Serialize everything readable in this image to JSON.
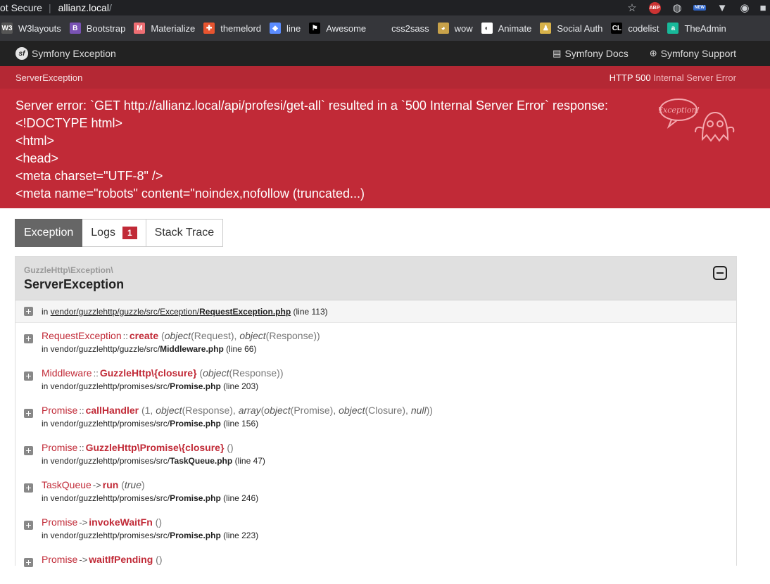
{
  "browser": {
    "security": "ot Secure",
    "url": "allianz.local",
    "url_trail": "/",
    "bookmarks": [
      {
        "label": "W3layouts",
        "icon": "w3-icon",
        "glyph": "W3",
        "color": "#555"
      },
      {
        "label": "Bootstrap",
        "icon": "bootstrap-icon",
        "glyph": "B",
        "color": "#7952b3"
      },
      {
        "label": "Materialize",
        "icon": "materialize-icon",
        "glyph": "M",
        "color": "#ee6e73"
      },
      {
        "label": "themelord",
        "icon": "themelord-icon",
        "glyph": "✚",
        "color": "#e8542f"
      },
      {
        "label": "line",
        "icon": "diamond-icon",
        "glyph": "◆",
        "color": "#5b8cff"
      },
      {
        "label": "Awesome",
        "icon": "flag-icon",
        "glyph": "⚑",
        "color": "#000"
      },
      {
        "label": "css2sass",
        "icon": "blank-icon",
        "glyph": "",
        "color": "#35363a"
      },
      {
        "label": "wow",
        "icon": "doge-icon",
        "glyph": "◕",
        "color": "#c8a24a"
      },
      {
        "label": "Animate",
        "icon": "globe-icon",
        "glyph": "◐",
        "color": "#fff"
      },
      {
        "label": "Social Auth",
        "icon": "person-icon",
        "glyph": "♟",
        "color": "#d8b24a"
      },
      {
        "label": "codelist",
        "icon": "cl-icon",
        "glyph": "CL",
        "color": "#000"
      },
      {
        "label": "TheAdmin",
        "icon": "a-icon",
        "glyph": "a",
        "color": "#18b99a"
      }
    ]
  },
  "symfony_bar": {
    "brand": "Symfony Exception",
    "docs": "Symfony Docs",
    "support": "Symfony Support"
  },
  "exception": {
    "class_short": "ServerException",
    "status_code": "HTTP 500",
    "status_text": "Internal Server Error",
    "message": "Server error: `GET http://allianz.local/api/profesi/get-all` resulted in a `500 Internal Server Error` response:\n<!DOCTYPE html>\n<html>\n<head>\n<meta charset=\"UTF-8\" />\n<meta name=\"robots\" content=\"noindex,nofollow (truncated...)",
    "ghost_label": "Exception!"
  },
  "tabs": {
    "exception": "Exception",
    "logs": "Logs",
    "logs_count": "1",
    "stack": "Stack Trace"
  },
  "trace": {
    "namespace": "GuzzleHttp\\Exception\\",
    "class": "ServerException",
    "first": {
      "prefix": "in",
      "path": "vendor/guzzlehttp/guzzle/src/Exception/",
      "file": "RequestException.php",
      "line": "(line 113)"
    },
    "frames": [
      {
        "cls": "RequestException",
        "op": "::",
        "fn": "create",
        "args_html": "(<i>object</i>(Request), <i>object</i>(Response))",
        "dir": "in vendor/guzzlehttp/guzzle/src/",
        "file": "Middleware.php",
        "line": "(line 66)"
      },
      {
        "cls": "Middleware",
        "op": "::",
        "fn": "GuzzleHttp\\{closure}",
        "args_html": "(<i>object</i>(Response))",
        "dir": "in vendor/guzzlehttp/promises/src/",
        "file": "Promise.php",
        "line": "(line 203)"
      },
      {
        "cls": "Promise",
        "op": "::",
        "fn": "callHandler",
        "args_html": "(1, <i>object</i>(Response), <i>array</i>(<i>object</i>(Promise), <i>object</i>(Closure), <i>null</i>))",
        "dir": "in vendor/guzzlehttp/promises/src/",
        "file": "Promise.php",
        "line": "(line 156)"
      },
      {
        "cls": "Promise",
        "op": "::",
        "fn": "GuzzleHttp\\Promise\\{closure}",
        "args_html": "()",
        "dir": "in vendor/guzzlehttp/promises/src/",
        "file": "TaskQueue.php",
        "line": "(line 47)"
      },
      {
        "cls": "TaskQueue",
        "op": "->",
        "fn": "run",
        "args_html": "(<i>true</i>)",
        "dir": "in vendor/guzzlehttp/promises/src/",
        "file": "Promise.php",
        "line": "(line 246)"
      },
      {
        "cls": "Promise",
        "op": "->",
        "fn": "invokeWaitFn",
        "args_html": "()",
        "dir": "in vendor/guzzlehttp/promises/src/",
        "file": "Promise.php",
        "line": "(line 223)"
      },
      {
        "cls": "Promise",
        "op": "->",
        "fn": "waitIfPending",
        "args_html": "()",
        "dir": "",
        "file": "",
        "line": ""
      }
    ]
  }
}
